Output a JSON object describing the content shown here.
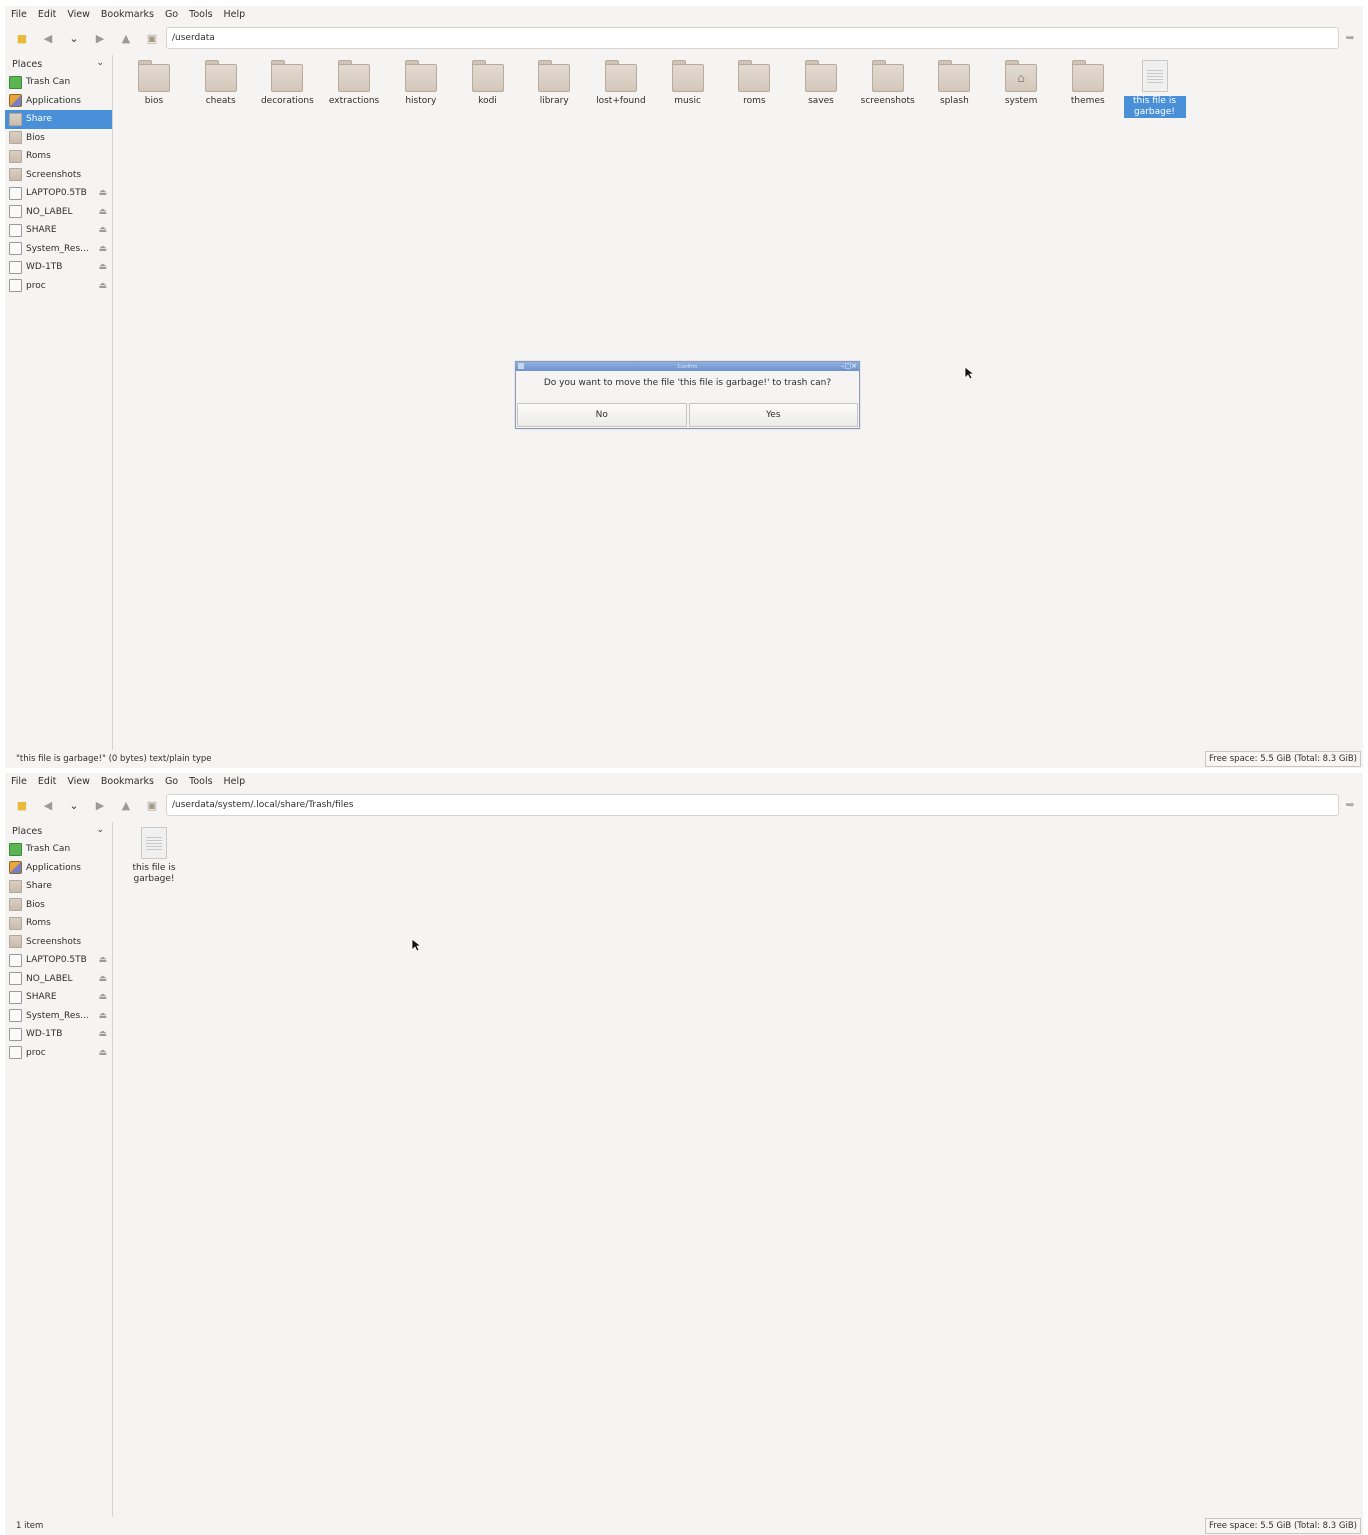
{
  "menu": [
    "File",
    "Edit",
    "View",
    "Bookmarks",
    "Go",
    "Tools",
    "Help"
  ],
  "places_label": "Places",
  "sidebar_items": [
    {
      "label": "Trash Can",
      "icon": "trash-icon"
    },
    {
      "label": "Applications",
      "icon": "applications-icon"
    },
    {
      "label": "Share",
      "icon": "folder-icon"
    },
    {
      "label": "Bios",
      "icon": "folder-icon"
    },
    {
      "label": "Roms",
      "icon": "folder-icon"
    },
    {
      "label": "Screenshots",
      "icon": "folder-icon"
    },
    {
      "label": "LAPTOP0.5TB",
      "icon": "drive-icon",
      "eject": true
    },
    {
      "label": "NO_LABEL",
      "icon": "drive-icon",
      "eject": true
    },
    {
      "label": "SHARE",
      "icon": "drive-icon",
      "eject": true
    },
    {
      "label": "System_Res...",
      "icon": "drive-icon",
      "eject": true
    },
    {
      "label": "WD-1TB",
      "icon": "drive-icon",
      "eject": true
    },
    {
      "label": "proc",
      "icon": "drive-icon",
      "eject": true
    }
  ],
  "pane1": {
    "path": "/userdata",
    "selected_sidebar": "Share",
    "items": [
      {
        "label": "bios",
        "type": "folder"
      },
      {
        "label": "cheats",
        "type": "folder"
      },
      {
        "label": "decorations",
        "type": "folder"
      },
      {
        "label": "extractions",
        "type": "folder"
      },
      {
        "label": "history",
        "type": "folder"
      },
      {
        "label": "kodi",
        "type": "folder"
      },
      {
        "label": "library",
        "type": "folder"
      },
      {
        "label": "lost+found",
        "type": "folder"
      },
      {
        "label": "music",
        "type": "folder"
      },
      {
        "label": "roms",
        "type": "folder"
      },
      {
        "label": "saves",
        "type": "folder"
      },
      {
        "label": "screenshots",
        "type": "folder"
      },
      {
        "label": "splash",
        "type": "folder"
      },
      {
        "label": "system",
        "type": "home-folder"
      },
      {
        "label": "themes",
        "type": "folder"
      },
      {
        "label": "this file is garbage!",
        "type": "file",
        "selected": true
      }
    ],
    "status_left": "\"this file is garbage!\" (0 bytes) text/plain type",
    "status_right": "Free space: 5.5 GiB (Total: 8.3 GiB)"
  },
  "dialog": {
    "title": "Confirm",
    "message": "Do you want to move the file 'this file is garbage!' to trash can?",
    "no_label": "No",
    "yes_label": "Yes"
  },
  "pane2": {
    "path": "/userdata/system/.local/share/Trash/files",
    "selected_sidebar": "",
    "items": [
      {
        "label": "this file is garbage!",
        "type": "file",
        "selected": false
      }
    ],
    "status_left": "1 item",
    "status_right": "Free space: 5.5 GiB (Total: 8.3 GiB)"
  },
  "colors": {
    "selection": "#4a90d9",
    "background": "#f5f4f2",
    "dialog_title": "#7b9dd4"
  }
}
